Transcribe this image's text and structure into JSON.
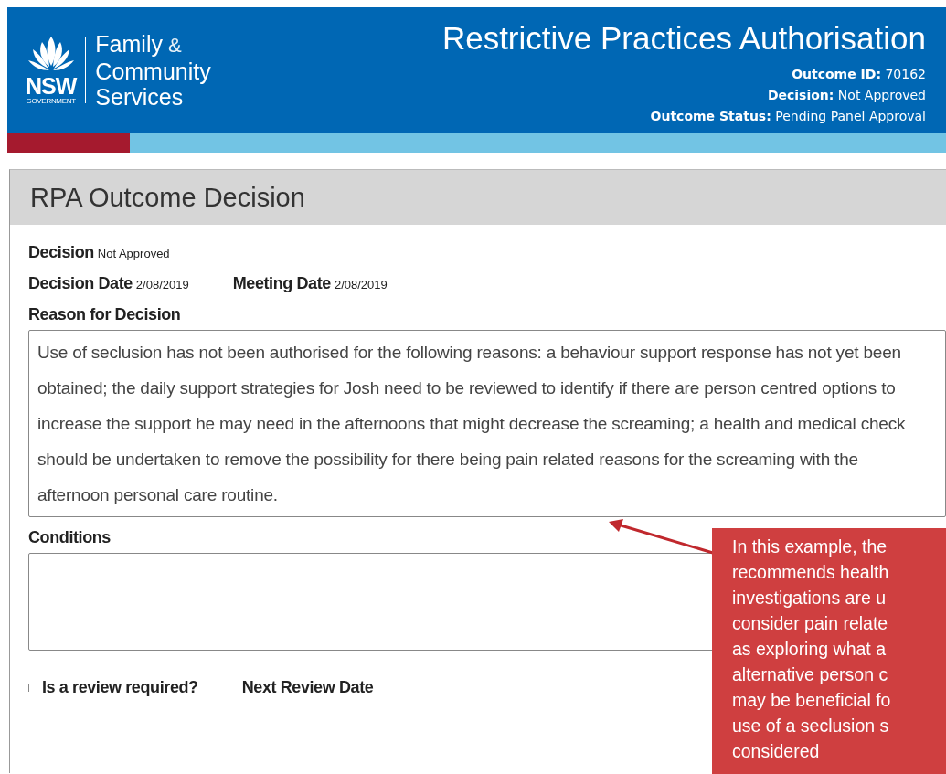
{
  "header": {
    "logo": {
      "mark": "NSW",
      "sub": "GOVERNMENT",
      "words": [
        "Family",
        "&",
        "Community",
        "Services"
      ]
    },
    "title": "Restrictive Practices Authorisation",
    "meta": [
      {
        "label": "Outcome ID:",
        "value": "70162"
      },
      {
        "label": "Decision:",
        "value": "Not Approved"
      },
      {
        "label": "Outcome Status:",
        "value": "Pending Panel Approval"
      }
    ]
  },
  "panel": {
    "title": "RPA Outcome Decision",
    "decision": {
      "label": "Decision",
      "value": "Not Approved"
    },
    "dates": [
      {
        "label": "Decision Date",
        "value": "2/08/2019"
      },
      {
        "label": "Meeting Date",
        "value": "2/08/2019"
      }
    ],
    "reason": {
      "label": "Reason for Decision",
      "value": "Use of seclusion has not been authorised for the following reasons: a behaviour support response has not yet been obtained; the daily support strategies for Josh need to be reviewed to identify if there are person centred options to increase the support he may need in the afternoons that might decrease the screaming; a health and medical check should be undertaken to remove the possibility for there being pain related reasons for the screaming with the afternoon personal care routine."
    },
    "conditions": {
      "label": "Conditions"
    },
    "review": {
      "label": "Is a review required?",
      "checked": false
    },
    "next_review": {
      "label": "Next Review Date"
    }
  },
  "callout": {
    "lines": [
      "In this example, the",
      "recommends health",
      "investigations are u",
      "consider pain relate",
      "as exploring what a",
      "alternative person c",
      "may be beneficial fo",
      "use of a seclusion s",
      "considered"
    ]
  }
}
